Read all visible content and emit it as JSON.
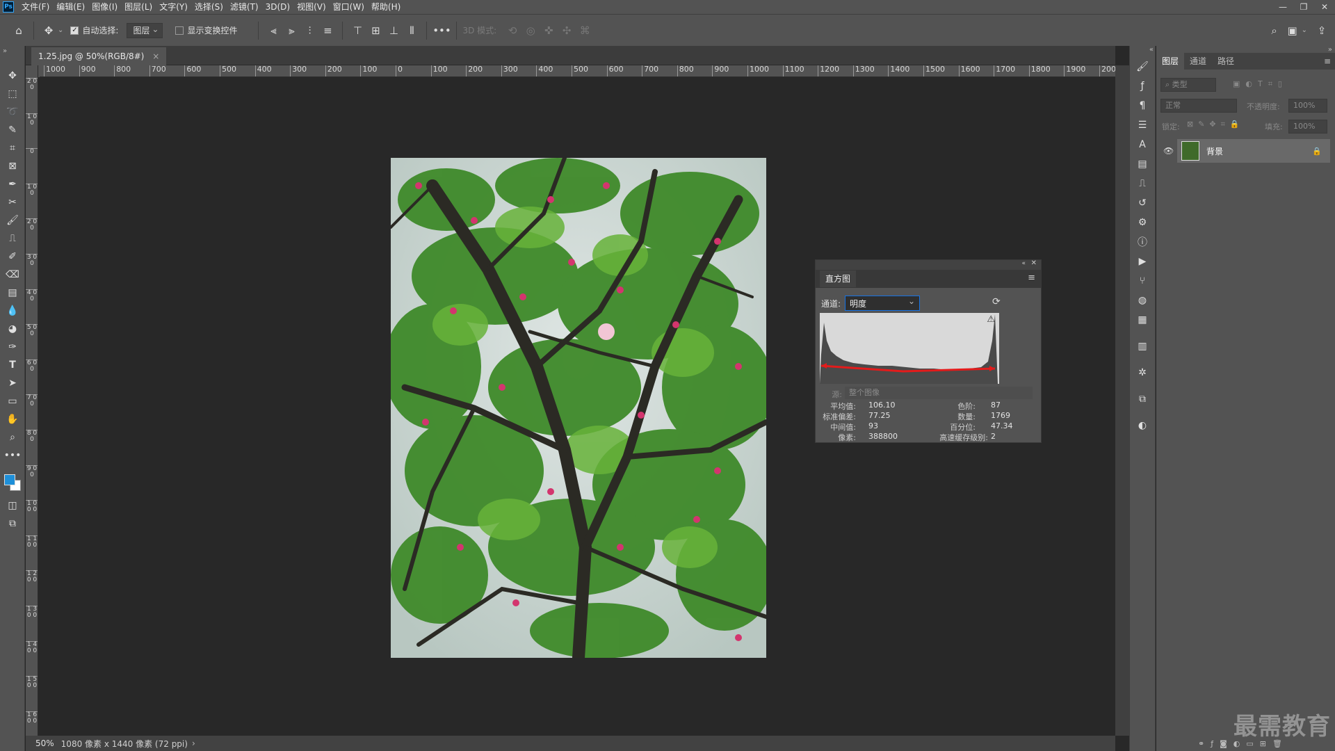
{
  "menubar": {
    "logo": "Ps",
    "items": [
      "文件(F)",
      "编辑(E)",
      "图像(I)",
      "图层(L)",
      "文字(Y)",
      "选择(S)",
      "滤镜(T)",
      "3D(D)",
      "视图(V)",
      "窗口(W)",
      "帮助(H)"
    ]
  },
  "options": {
    "auto_select_label": "自动选择:",
    "auto_select_value": "图层",
    "show_transform_label": "显示变换控件",
    "mode_3d_label": "3D 模式:"
  },
  "document": {
    "tab_title": "1.25.jpg @ 50%(RGB/8#)",
    "zoom": "50%",
    "info": "1080 像素 x 1440 像素 (72 ppi)"
  },
  "ruler": {
    "h_ticks": [
      "1000",
      "900",
      "800",
      "700",
      "600",
      "500",
      "400",
      "300",
      "200",
      "100",
      "0",
      "100",
      "200",
      "300",
      "400",
      "500",
      "600",
      "700",
      "800",
      "900",
      "1000",
      "1100",
      "1200",
      "1300",
      "1400",
      "1500",
      "1600",
      "1700",
      "1800",
      "1900",
      "2000"
    ],
    "v_ticks": [
      "2 0 0",
      "1 0 0",
      "0",
      "1 0 0",
      "2 0 0",
      "3 0 0",
      "4 0 0",
      "5 0 0",
      "6 0 0",
      "7 0 0",
      "8 0 0",
      "9 0 0",
      "1 0 0 0",
      "1 1 0 0",
      "1 2 0 0",
      "1 3 0 0",
      "1 4 0 0",
      "1 5 0 0",
      "1 6 0 0"
    ]
  },
  "histogram": {
    "title": "直方图",
    "channel_label": "通道:",
    "channel_value": "明度",
    "source_label": "源:",
    "source_value": "整个图像",
    "stats": {
      "mean_label": "平均值:",
      "mean": "106.10",
      "std_label": "标准偏差:",
      "std": "77.25",
      "median_label": "中间值:",
      "median": "93",
      "pixels_label": "像素:",
      "pixels": "388800",
      "level_label": "色阶:",
      "level": "87",
      "count_label": "数量:",
      "count": "1769",
      "percentile_label": "百分位:",
      "percentile": "47.34",
      "cache_label": "高速缓存级别:",
      "cache": "2"
    }
  },
  "layers_panel": {
    "tabs": [
      "图层",
      "通道",
      "路径"
    ],
    "kind_placeholder": "类型",
    "blend_mode": "正常",
    "opacity_label": "不透明度:",
    "opacity_value": "100%",
    "lock_label": "锁定:",
    "fill_label": "填充:",
    "fill_value": "100%",
    "layer_name": "背景"
  },
  "watermark": "最需教育",
  "colors": {
    "foreground": "#1e8fd8",
    "background": "#ffffff",
    "accent": "#1473e6"
  }
}
